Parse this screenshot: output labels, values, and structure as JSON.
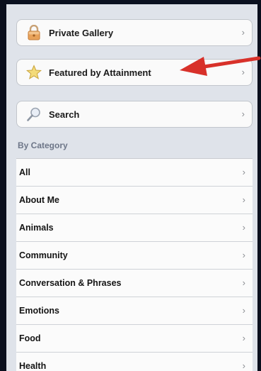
{
  "groups": {
    "private_gallery": {
      "label": "Private Gallery"
    },
    "featured": {
      "label": "Featured by Attainment"
    },
    "search": {
      "label": "Search"
    }
  },
  "section": {
    "header": "By Category"
  },
  "categories": [
    "All",
    "About Me",
    "Animals",
    "Community",
    "Conversation & Phrases",
    "Emotions",
    "Food",
    "Health"
  ],
  "chevron": "›",
  "colors": {
    "panel": "#dfe3ea",
    "section_header": "#6d7688",
    "annotation_arrow": "#d8312a"
  },
  "icons": {
    "private_gallery": "lock-icon",
    "featured": "star-icon",
    "search": "magnifier-icon",
    "annotation": "red-arrow-annotation"
  }
}
